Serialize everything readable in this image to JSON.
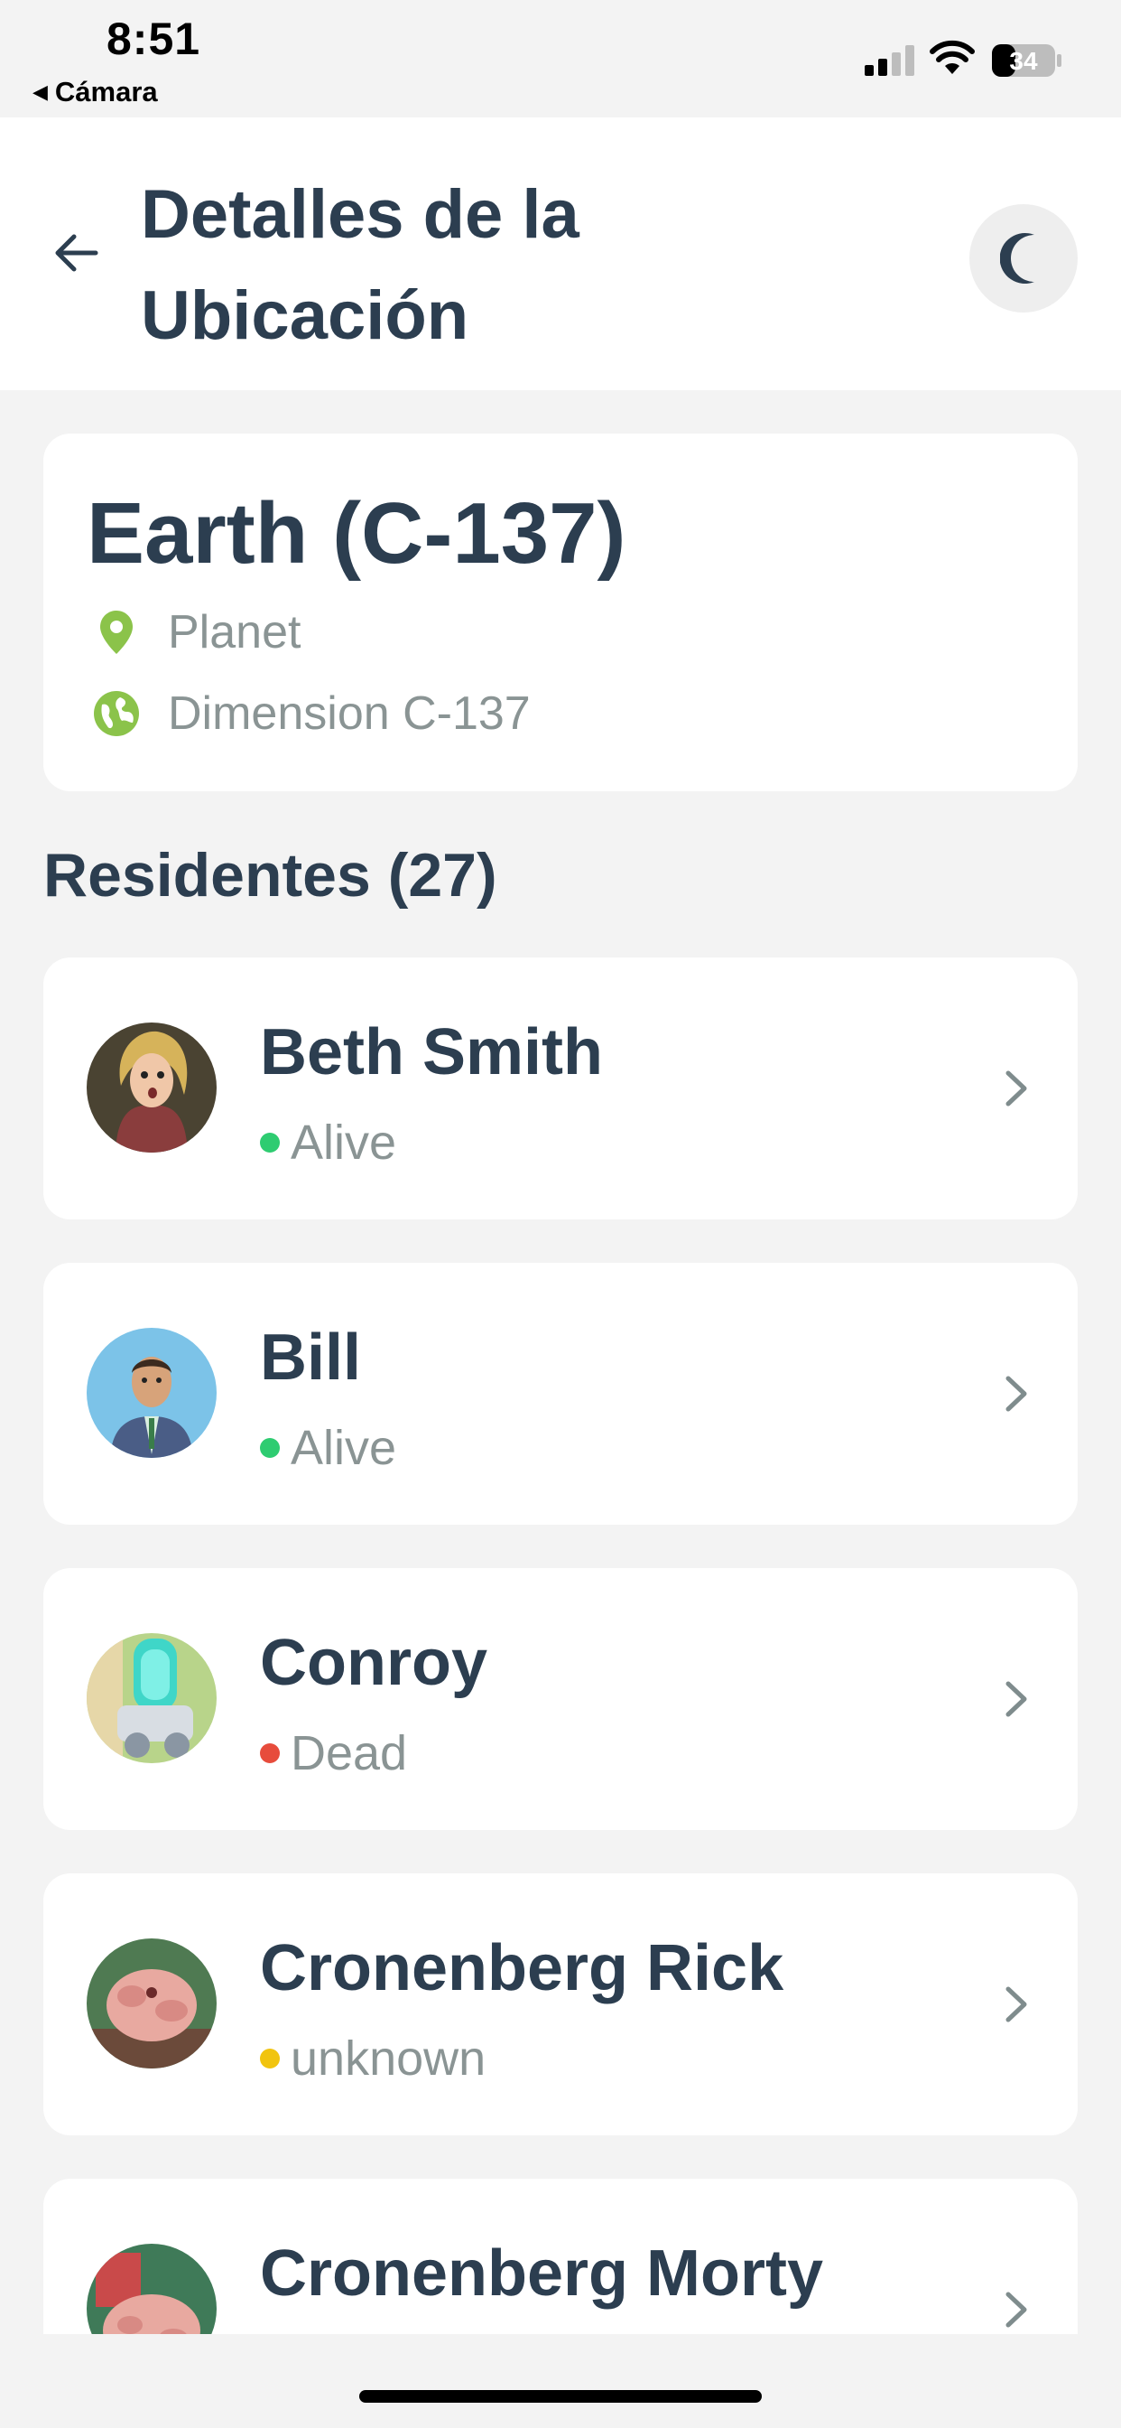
{
  "status_bar": {
    "time": "8:51",
    "back_app": "Cámara",
    "battery": "34"
  },
  "header": {
    "title": "Detalles de la Ubicación"
  },
  "location": {
    "name": "Earth (C-137)",
    "type": "Planet",
    "dimension": "Dimension C-137"
  },
  "residents_title": "Residentes (27)",
  "residents": [
    {
      "name": "Beth Smith",
      "status": "Alive",
      "status_color": "#2ecc71"
    },
    {
      "name": "Bill",
      "status": "Alive",
      "status_color": "#2ecc71"
    },
    {
      "name": "Conroy",
      "status": "Dead",
      "status_color": "#e74c3c"
    },
    {
      "name": "Cronenberg Rick",
      "status": "unknown",
      "status_color": "#f1c40f"
    },
    {
      "name": "Cronenberg Morty",
      "status": "",
      "status_color": "#f1c40f"
    }
  ],
  "colors": {
    "accent": "#8bc34a",
    "text_primary": "#2c3e50",
    "text_secondary": "#8a9494"
  }
}
